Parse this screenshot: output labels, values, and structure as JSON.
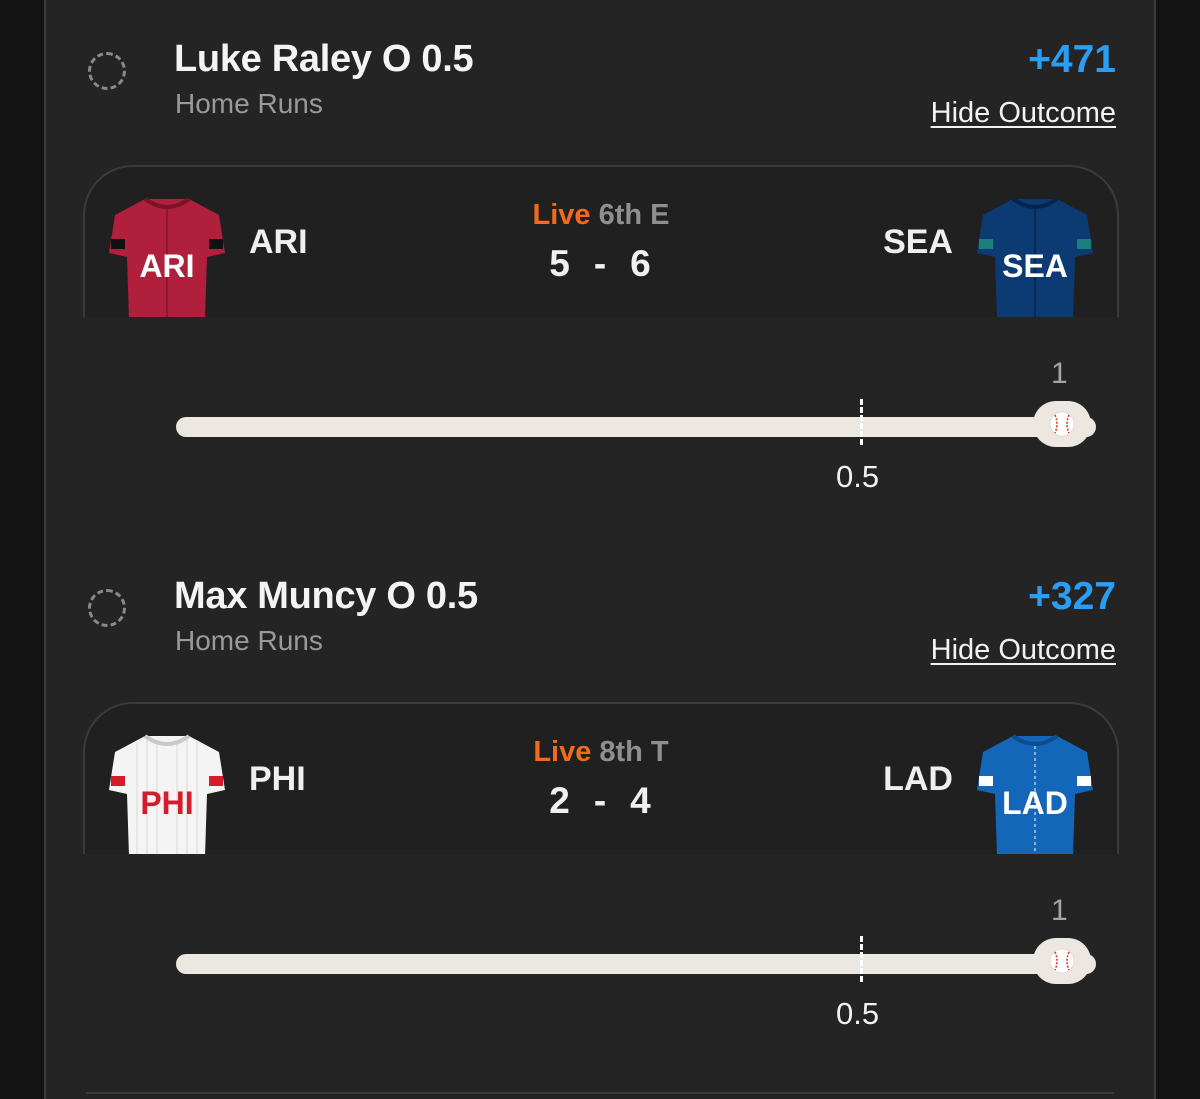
{
  "legs": [
    {
      "player": "Luke Raley O 0.5",
      "stat": "Home Runs",
      "odds": "+471",
      "hide_label": "Hide Outcome",
      "game": {
        "home": {
          "abbr": "ARI",
          "jersey_text": "ARI",
          "color": "#b01f3c"
        },
        "away": {
          "abbr": "SEA",
          "jersey_text": "SEA",
          "color": "#0c3a73"
        },
        "status": "Live",
        "inning": "6th E",
        "home_score": "5",
        "away_score": "6",
        "separator": "-"
      },
      "progress": {
        "max_label": "1",
        "marker_label": "0.5",
        "value": 1,
        "icon": "baseball-icon"
      }
    },
    {
      "player": "Max Muncy O 0.5",
      "stat": "Home Runs",
      "odds": "+327",
      "hide_label": "Hide Outcome",
      "game": {
        "home": {
          "abbr": "PHI",
          "jersey_text": "PHI",
          "color": "#f4f4f4"
        },
        "away": {
          "abbr": "LAD",
          "jersey_text": "LAD",
          "color": "#1466b8"
        },
        "status": "Live",
        "inning": "8th T",
        "home_score": "2",
        "away_score": "4",
        "separator": "-"
      },
      "progress": {
        "max_label": "1",
        "marker_label": "0.5",
        "value": 1,
        "icon": "baseball-icon"
      }
    }
  ],
  "colors": {
    "accent_odds": "#2a9df4",
    "live": "#f26a1b",
    "background": "#242424",
    "track": "#ece7e1"
  }
}
